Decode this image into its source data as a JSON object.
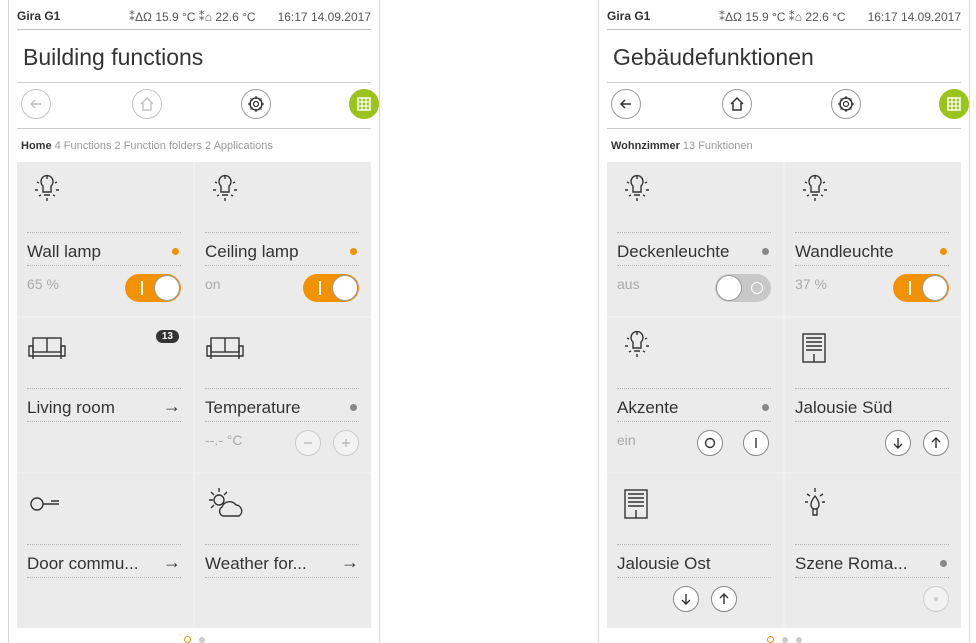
{
  "left": {
    "device": "Gira G1",
    "temps": "⁑ΔΩ 15.9 °C  ⁑⌂ 22.6 °C",
    "time": "16:17  14.09.2017",
    "title": "Building functions",
    "breadcrumb_home": "Home",
    "breadcrumb_rest": " 4 Functions 2 Function folders 2 Applications",
    "tiles": [
      {
        "label": "Wall lamp",
        "value": "65 %"
      },
      {
        "label": "Ceiling lamp",
        "value": "on"
      },
      {
        "label": "Living room",
        "arrow": "→",
        "badge": "13"
      },
      {
        "label": "Temperature",
        "value": "--.- °C"
      },
      {
        "label": "Door commu...",
        "arrow": "→"
      },
      {
        "label": "Weather for...",
        "arrow": "→"
      }
    ]
  },
  "right": {
    "device": "Gira G1",
    "temps": "⁑ΔΩ 15.9 °C  ⁑⌂ 22.6 °C",
    "time": "16:17  14.09.2017",
    "title": "Gebäudefunktionen",
    "breadcrumb_home": "Wohnzimmer",
    "breadcrumb_rest": " 13 Funktionen",
    "tiles": [
      {
        "label": "Deckenleuchte",
        "value": "aus"
      },
      {
        "label": "Wandleuchte",
        "value": "37 %"
      },
      {
        "label": "Akzente",
        "value": "ein"
      },
      {
        "label": "Jalousie Süd"
      },
      {
        "label": "Jalousie Ost"
      },
      {
        "label": "Szene Roma..."
      }
    ]
  },
  "colors": {
    "accent": "#f39200",
    "active_nav": "#9ac31c"
  },
  "icons": [
    "back-icon",
    "home-icon",
    "settings-icon",
    "grid-icon",
    "lamp-icon",
    "sofa-icon",
    "key-icon",
    "weather-icon",
    "blind-icon",
    "scene-icon"
  ]
}
